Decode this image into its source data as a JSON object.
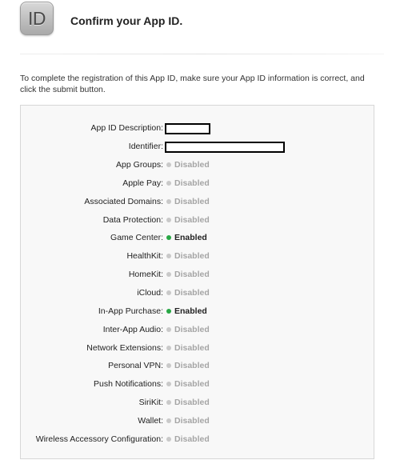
{
  "header": {
    "icon_text": "ID",
    "title": "Confirm your App ID."
  },
  "intro_text": "To complete the registration of this App ID, make sure your App ID information is correct, and click the submit button.",
  "details": {
    "description_label": "App ID Description:",
    "identifier_label": "Identifier:",
    "capabilities": [
      {
        "label": "App Groups:",
        "status": "Disabled",
        "enabled": false
      },
      {
        "label": "Apple Pay:",
        "status": "Disabled",
        "enabled": false
      },
      {
        "label": "Associated Domains:",
        "status": "Disabled",
        "enabled": false
      },
      {
        "label": "Data Protection:",
        "status": "Disabled",
        "enabled": false
      },
      {
        "label": "Game Center:",
        "status": "Enabled",
        "enabled": true
      },
      {
        "label": "HealthKit:",
        "status": "Disabled",
        "enabled": false
      },
      {
        "label": "HomeKit:",
        "status": "Disabled",
        "enabled": false
      },
      {
        "label": "iCloud:",
        "status": "Disabled",
        "enabled": false
      },
      {
        "label": "In-App Purchase:",
        "status": "Enabled",
        "enabled": true
      },
      {
        "label": "Inter-App Audio:",
        "status": "Disabled",
        "enabled": false
      },
      {
        "label": "Network Extensions:",
        "status": "Disabled",
        "enabled": false
      },
      {
        "label": "Personal VPN:",
        "status": "Disabled",
        "enabled": false
      },
      {
        "label": "Push Notifications:",
        "status": "Disabled",
        "enabled": false
      },
      {
        "label": "SiriKit:",
        "status": "Disabled",
        "enabled": false
      },
      {
        "label": "Wallet:",
        "status": "Disabled",
        "enabled": false
      },
      {
        "label": "Wireless Accessory Configuration:",
        "status": "Disabled",
        "enabled": false
      }
    ]
  },
  "colors": {
    "enabled_dot": "#28a745",
    "disabled_dot": "#c9c9c9",
    "disabled_text": "#a5a5a5",
    "box_background": "#f8f8f8",
    "box_border": "#d7d7d7"
  },
  "icons": {
    "status_enabled": "green-dot-icon",
    "status_disabled": "gray-dot-icon"
  }
}
